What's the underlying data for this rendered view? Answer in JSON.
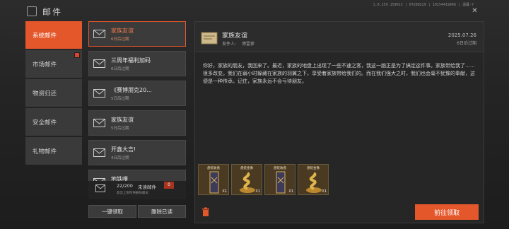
{
  "header": {
    "title": "邮件",
    "version": "1.0.259.159013 | 07280229 | 10154419848 | 温暮-7",
    "close_icon": "close-icon"
  },
  "nav": {
    "items": [
      {
        "label": "系统邮件",
        "active": true,
        "badge": false
      },
      {
        "label": "市场邮件",
        "active": false,
        "badge": true
      },
      {
        "label": "物资归还",
        "active": false,
        "badge": false
      },
      {
        "label": "安全邮件",
        "active": false,
        "badge": false
      },
      {
        "label": "礼物邮件",
        "active": false,
        "badge": false
      }
    ]
  },
  "mail_list": [
    {
      "title": "家族友谊",
      "expires": "6日后过期",
      "active": true
    },
    {
      "title": "三周年福利加码",
      "expires": "6日后过期",
      "active": false
    },
    {
      "title": "《赛博朋克20...",
      "expires": "5日后过期",
      "active": false
    },
    {
      "title": "家族友谊",
      "expires": "5日后过期",
      "active": false
    },
    {
      "title": "开鑫大吉!",
      "expires": "4日后过期",
      "active": false
    },
    {
      "title": "地铁噗",
      "expires": "",
      "active": false
    }
  ],
  "storage": {
    "count": "22/200",
    "unread_label": "未读邮件",
    "unread_count": "0",
    "note": "超出上限时将删除最早"
  },
  "buttons": {
    "claim_all": "一键领取",
    "delete_read": "删除已读",
    "go_claim": "前往领取"
  },
  "detail": {
    "title": "家族友谊",
    "sender_label": "发件人:",
    "sender": "博雷萝",
    "date": "2025.07.26",
    "expires": "6日后过期",
    "body": "你好，家族的朋友，我回来了。最近，家族的地盘上出现了一些不速之客，我这一趟正是为了搞定这件事。家族带给我了……很多改变。我们在弱小时躲藏在家族的羽翼之下，享受着家族带给我们的。而在我们强大之时，我们也会毫不犹豫的奉献，这便是一种传承。记住，家族永远不会亏待朋友。",
    "attachments": [
      {
        "label": "盘蛇收盘",
        "qty": "X1",
        "kind": "banner"
      },
      {
        "label": "盘蛇金像",
        "qty": "X1",
        "kind": "snake"
      },
      {
        "label": "盘蛇收盘",
        "qty": "X1",
        "kind": "banner"
      },
      {
        "label": "盘蛇金像",
        "qty": "X1",
        "kind": "snake"
      }
    ]
  },
  "colors": {
    "accent": "#e4572b",
    "panel": "#3a3a3a",
    "background": "#1f1f1f"
  }
}
